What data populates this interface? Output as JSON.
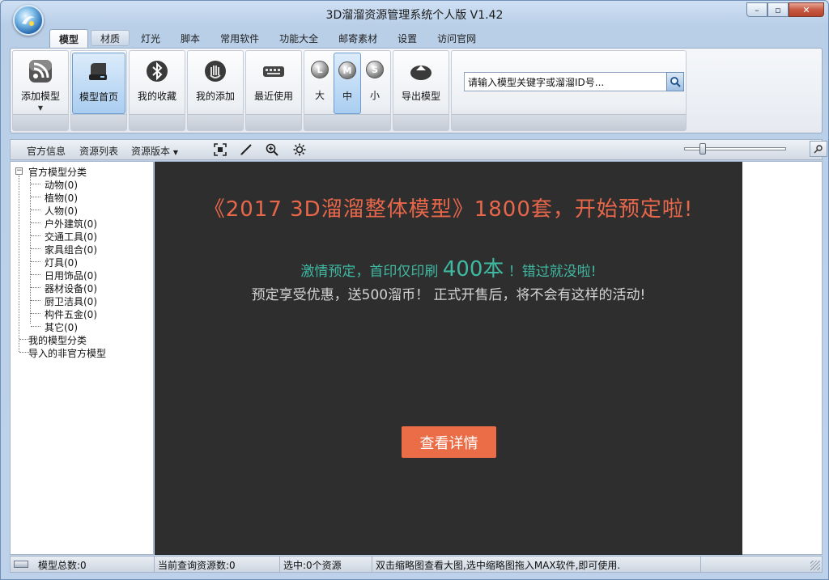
{
  "window": {
    "title": "3D溜溜资源管理系统个人版 V1.42"
  },
  "tabs": [
    {
      "label": "模型",
      "state": "active"
    },
    {
      "label": "材质",
      "state": "highlight"
    },
    {
      "label": "灯光"
    },
    {
      "label": "脚本"
    },
    {
      "label": "常用软件"
    },
    {
      "label": "功能大全"
    },
    {
      "label": "邮寄素材"
    },
    {
      "label": "设置"
    },
    {
      "label": "访问官网"
    }
  ],
  "ribbon": {
    "add_model": "添加模型",
    "model_home": "模型首页",
    "my_favorites": "我的收藏",
    "my_added": "我的添加",
    "recent": "最近使用",
    "sizes": [
      {
        "icon": "L",
        "label": "大"
      },
      {
        "icon": "M",
        "label": "中"
      },
      {
        "icon": "S",
        "label": "小"
      }
    ],
    "export_model": "导出模型",
    "search_placeholder": "请输入模型关键字或溜溜ID号..."
  },
  "toolbar": {
    "official_info": "官方信息",
    "resource_list": "资源列表",
    "resource_version": "资源版本"
  },
  "tree": {
    "root": "官方模型分类",
    "children": [
      "动物(0)",
      "植物(0)",
      "人物(0)",
      "户外建筑(0)",
      "交通工具(0)",
      "家具组合(0)",
      "灯具(0)",
      "日用饰品(0)",
      "器材设备(0)",
      "厨卫洁具(0)",
      "构件五金(0)",
      "其它(0)"
    ],
    "my_categories": "我的模型分类",
    "imported": "导入的非官方模型"
  },
  "banner": {
    "title": "《2017 3D溜溜整体模型》1800套，开始预定啦!",
    "line2_pre": "激情预定，首印仅印刷",
    "line2_big": "400本",
    "line2_post": "！错过就没啦!",
    "line3": "预定享受优惠，送500溜币！ 正式开售后，将不会有这样的活动!",
    "button": "查看详情"
  },
  "status": {
    "total": "模型总数:0",
    "query": "当前查询资源数:0",
    "selected": "选中:0个资源",
    "hint": "双击缩略图查看大图,选中缩略图拖入MAX软件,即可使用."
  },
  "colors": {
    "banner_bg": "#2e2e2e",
    "banner_title": "#e8674a",
    "banner_teal": "#3fb9a2",
    "banner_button": "#eb6d47"
  }
}
